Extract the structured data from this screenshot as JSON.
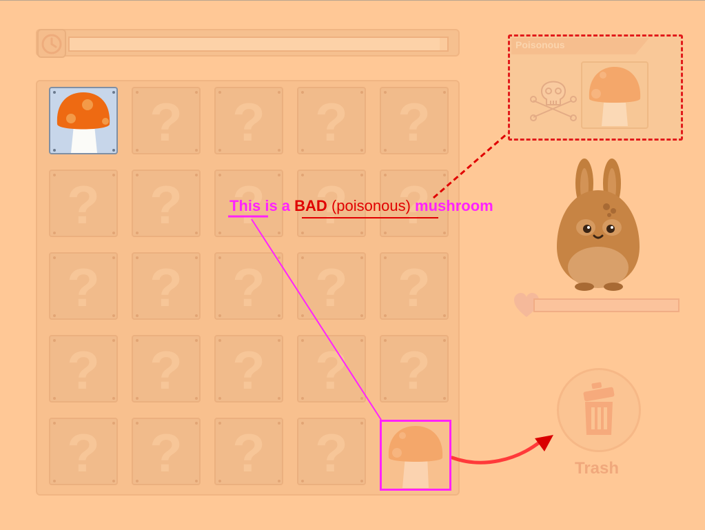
{
  "poison_panel": {
    "label": "Poisonous"
  },
  "caption": {
    "part_this": "This ",
    "part_is_a": "is a ",
    "part_bad": "BAD",
    "part_poisonous": "(poisonous)",
    "part_mushroom": "mushroom"
  },
  "trash": {
    "label": "Trash"
  },
  "grid": {
    "rows": 5,
    "cols": 5,
    "hidden_symbol": "?",
    "revealed_cell": [
      0,
      0
    ],
    "highlighted_cell": [
      4,
      4
    ]
  },
  "colors": {
    "background": "#ffc896",
    "annotation_magenta": "#ff22ff",
    "annotation_red": "#e00000",
    "mushroom_cap": "#ee6a12",
    "revealed_cell_bg": "#c7d6ea"
  },
  "icons": {
    "timer": "clock-icon",
    "poison": "skull-crossbones-icon",
    "health": "heart-icon",
    "trash": "trash-can-icon",
    "character": "bunny-character"
  },
  "timer_progress": 0.98,
  "health_progress": 0.0
}
